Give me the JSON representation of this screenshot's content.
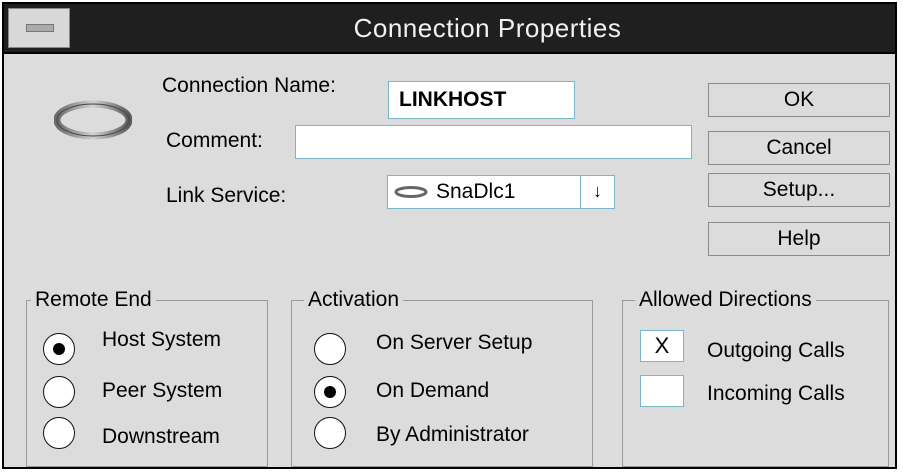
{
  "window": {
    "title": "Connection Properties"
  },
  "connection_name": {
    "label": "Connection Name:",
    "value": "LINKHOST"
  },
  "comment": {
    "label": "Comment:",
    "value": ""
  },
  "link_service": {
    "label": "Link Service:",
    "value": "SnaDlc1",
    "dropdown_glyph": "↓"
  },
  "buttons": {
    "ok": "OK",
    "cancel": "Cancel",
    "setup": "Setup...",
    "help": "Help"
  },
  "remote_end": {
    "title": "Remote End",
    "options": [
      "Host System",
      "Peer System",
      "Downstream"
    ],
    "selected": "Host System"
  },
  "activation": {
    "title": "Activation",
    "options": [
      "On Server Setup",
      "On Demand",
      "By Administrator"
    ],
    "selected": "On Demand"
  },
  "allowed_directions": {
    "title": "Allowed Directions",
    "outgoing": {
      "label": "Outgoing Calls",
      "mark": "X",
      "checked": true
    },
    "incoming": {
      "label": "Incoming Calls",
      "mark": "",
      "checked": false
    }
  },
  "icons": {
    "connection": "ring-icon",
    "link_service": "ring-icon"
  }
}
